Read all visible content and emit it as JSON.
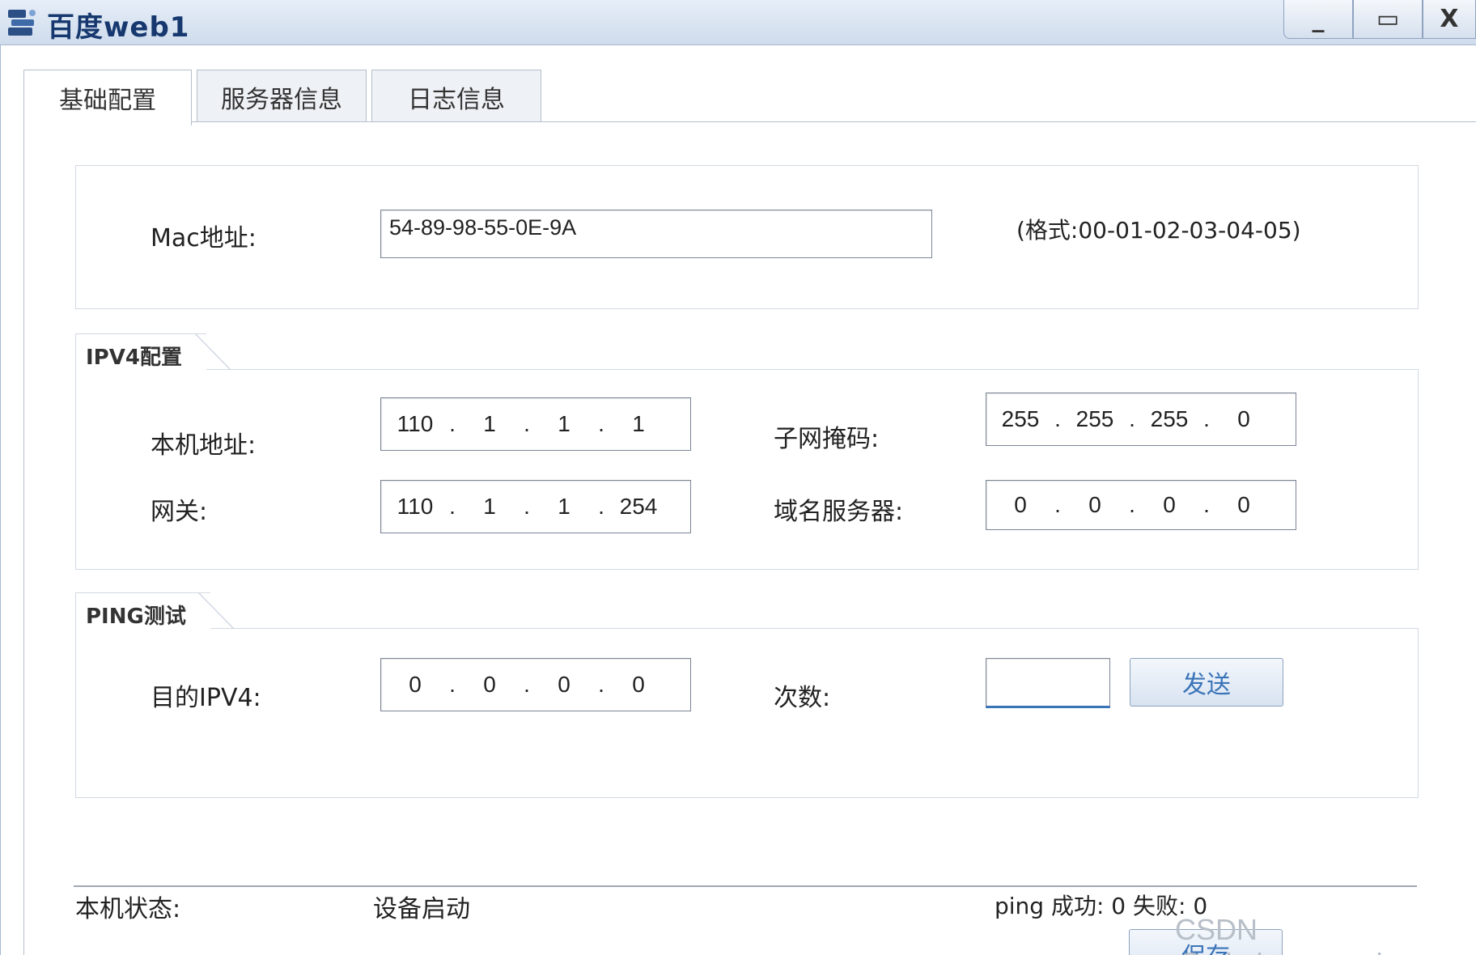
{
  "window": {
    "title": "百度web1",
    "controls": {
      "minimize": "_",
      "maximize": "▭",
      "close": "X"
    }
  },
  "tabs": [
    {
      "label": "基础配置",
      "active": true
    },
    {
      "label": "服务器信息",
      "active": false
    },
    {
      "label": "日志信息",
      "active": false
    }
  ],
  "mac": {
    "label": "Mac地址:",
    "value": "54-89-98-55-0E-9A",
    "format_hint": "(格式:00-01-02-03-04-05)"
  },
  "ipv4": {
    "legend": "IPV4配置",
    "host_label": "本机地址:",
    "host": [
      "110",
      "1",
      "1",
      "1"
    ],
    "mask_label": "子网掩码:",
    "mask": [
      "255",
      "255",
      "255",
      "0"
    ],
    "gateway_label": "网关:",
    "gateway": [
      "110",
      "1",
      "1",
      "254"
    ],
    "dns_label": "域名服务器:",
    "dns": [
      "0",
      "0",
      "0",
      "0"
    ]
  },
  "ping": {
    "legend": "PING测试",
    "target_label": "目的IPV4:",
    "target": [
      "0",
      "0",
      "0",
      "0"
    ],
    "count_label": "次数:",
    "count_value": "",
    "send_label": "发送"
  },
  "status": {
    "label": "本机状态:",
    "value": "设备启动",
    "ping_result": "ping 成功: 0 失败: 0"
  },
  "footer": {
    "save_label": "保存"
  },
  "watermark": "CSDN @wisdom_serein",
  "colors": {
    "titlebar": "#cfdcec",
    "accent": "#3a74b8",
    "title_text": "#16386e"
  }
}
